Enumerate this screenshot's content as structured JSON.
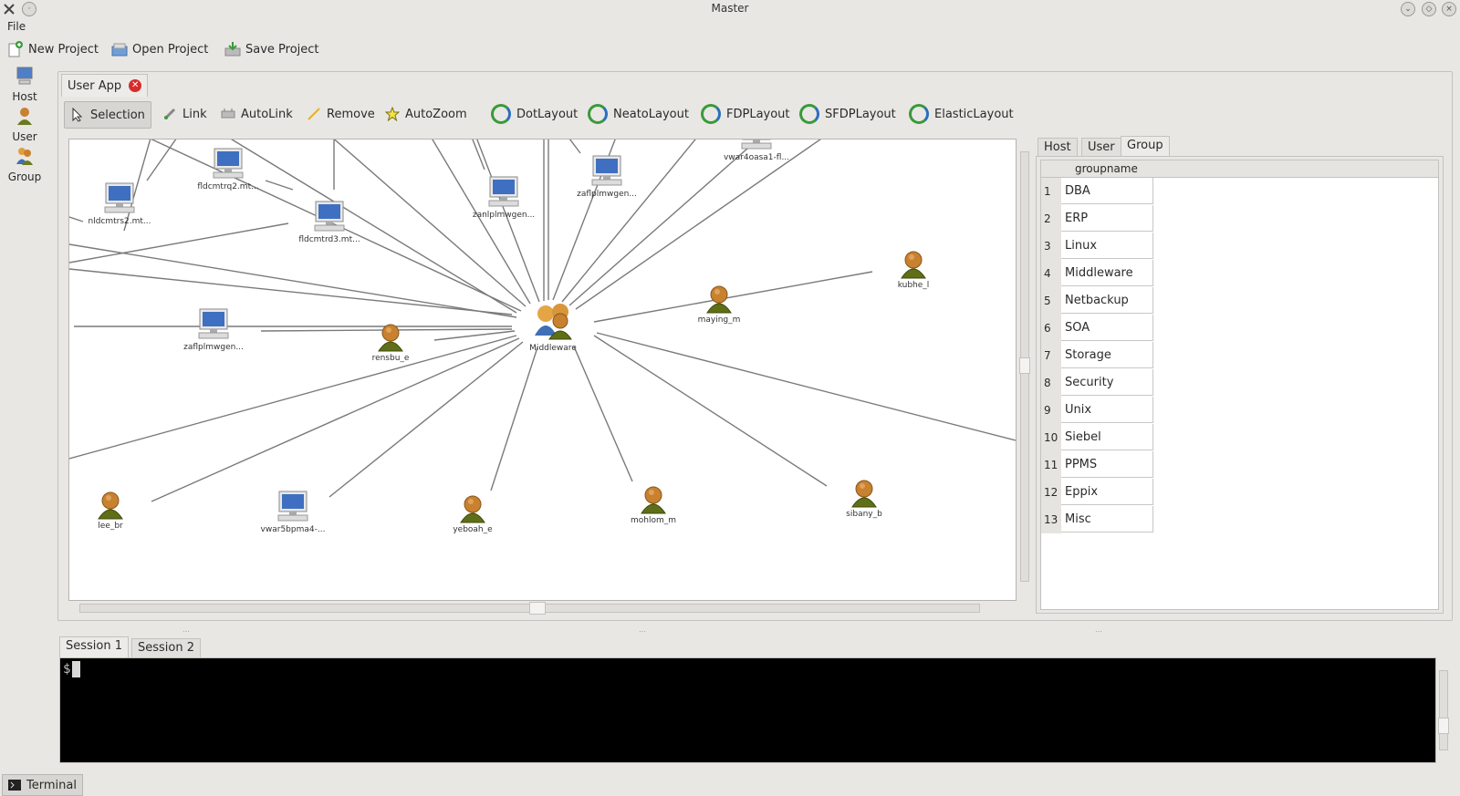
{
  "window": {
    "title": "Master"
  },
  "menu": {
    "file": "File"
  },
  "toolbar": {
    "new_project": "New Project",
    "open_project": "Open Project",
    "save_project": "Save Project"
  },
  "dock": {
    "host": "Host",
    "user": "User",
    "group": "Group"
  },
  "app_tab": {
    "label": "User App"
  },
  "modes": [
    {
      "label": "Selection",
      "icon": "pointer-icon",
      "active": true
    },
    {
      "label": "Link",
      "icon": "link-icon"
    },
    {
      "label": "AutoLink",
      "icon": "autolink-icon"
    },
    {
      "label": "Remove",
      "icon": "remove-icon"
    },
    {
      "label": "AutoZoom",
      "icon": "star-icon"
    },
    {
      "label": "DotLayout",
      "icon": "layout-icon"
    },
    {
      "label": "NeatoLayout",
      "icon": "layout-icon"
    },
    {
      "label": "FDPLayout",
      "icon": "layout-icon"
    },
    {
      "label": "SFDPLayout",
      "icon": "layout-icon"
    },
    {
      "label": "ElasticLayout",
      "icon": "layout-icon"
    }
  ],
  "graph": {
    "center": {
      "label": "Middleware",
      "type": "group"
    },
    "nodes": [
      {
        "label": "fldcmtrq2.mt...",
        "type": "host"
      },
      {
        "label": "nldcmtrs2.mt...",
        "type": "host"
      },
      {
        "label": "fldcmtrd3.mt...",
        "type": "host"
      },
      {
        "label": "zanlplmwgen...",
        "type": "host"
      },
      {
        "label": "zaflplmwgen...",
        "type": "host"
      },
      {
        "label": "vwar4oasa1-fl...",
        "type": "host"
      },
      {
        "label": "kubhe_l",
        "type": "user"
      },
      {
        "label": "maying_m",
        "type": "user"
      },
      {
        "label": "zaflplmwgen...",
        "type": "host"
      },
      {
        "label": "rensbu_e",
        "type": "user"
      },
      {
        "label": "lee_br",
        "type": "user"
      },
      {
        "label": "vwar5bpma4-...",
        "type": "host"
      },
      {
        "label": "yeboah_e",
        "type": "user"
      },
      {
        "label": "mohlom_m",
        "type": "user"
      },
      {
        "label": "sibany_b",
        "type": "user"
      }
    ]
  },
  "right_tabs": {
    "host": "Host",
    "user": "User",
    "group": "Group"
  },
  "group_table": {
    "header": "groupname",
    "rows": [
      {
        "n": "1",
        "name": "DBA"
      },
      {
        "n": "2",
        "name": "ERP"
      },
      {
        "n": "3",
        "name": "Linux"
      },
      {
        "n": "4",
        "name": "Middleware"
      },
      {
        "n": "5",
        "name": "Netbackup"
      },
      {
        "n": "6",
        "name": "SOA"
      },
      {
        "n": "7",
        "name": "Storage"
      },
      {
        "n": "8",
        "name": "Security"
      },
      {
        "n": "9",
        "name": "Unix"
      },
      {
        "n": "10",
        "name": "Siebel"
      },
      {
        "n": "11",
        "name": "PPMS"
      },
      {
        "n": "12",
        "name": "Eppix"
      },
      {
        "n": "13",
        "name": "Misc"
      }
    ]
  },
  "sessions": {
    "tab1": "Session 1",
    "tab2": "Session 2"
  },
  "terminal": {
    "prompt": "$"
  },
  "taskbar": {
    "terminal": "Terminal"
  }
}
